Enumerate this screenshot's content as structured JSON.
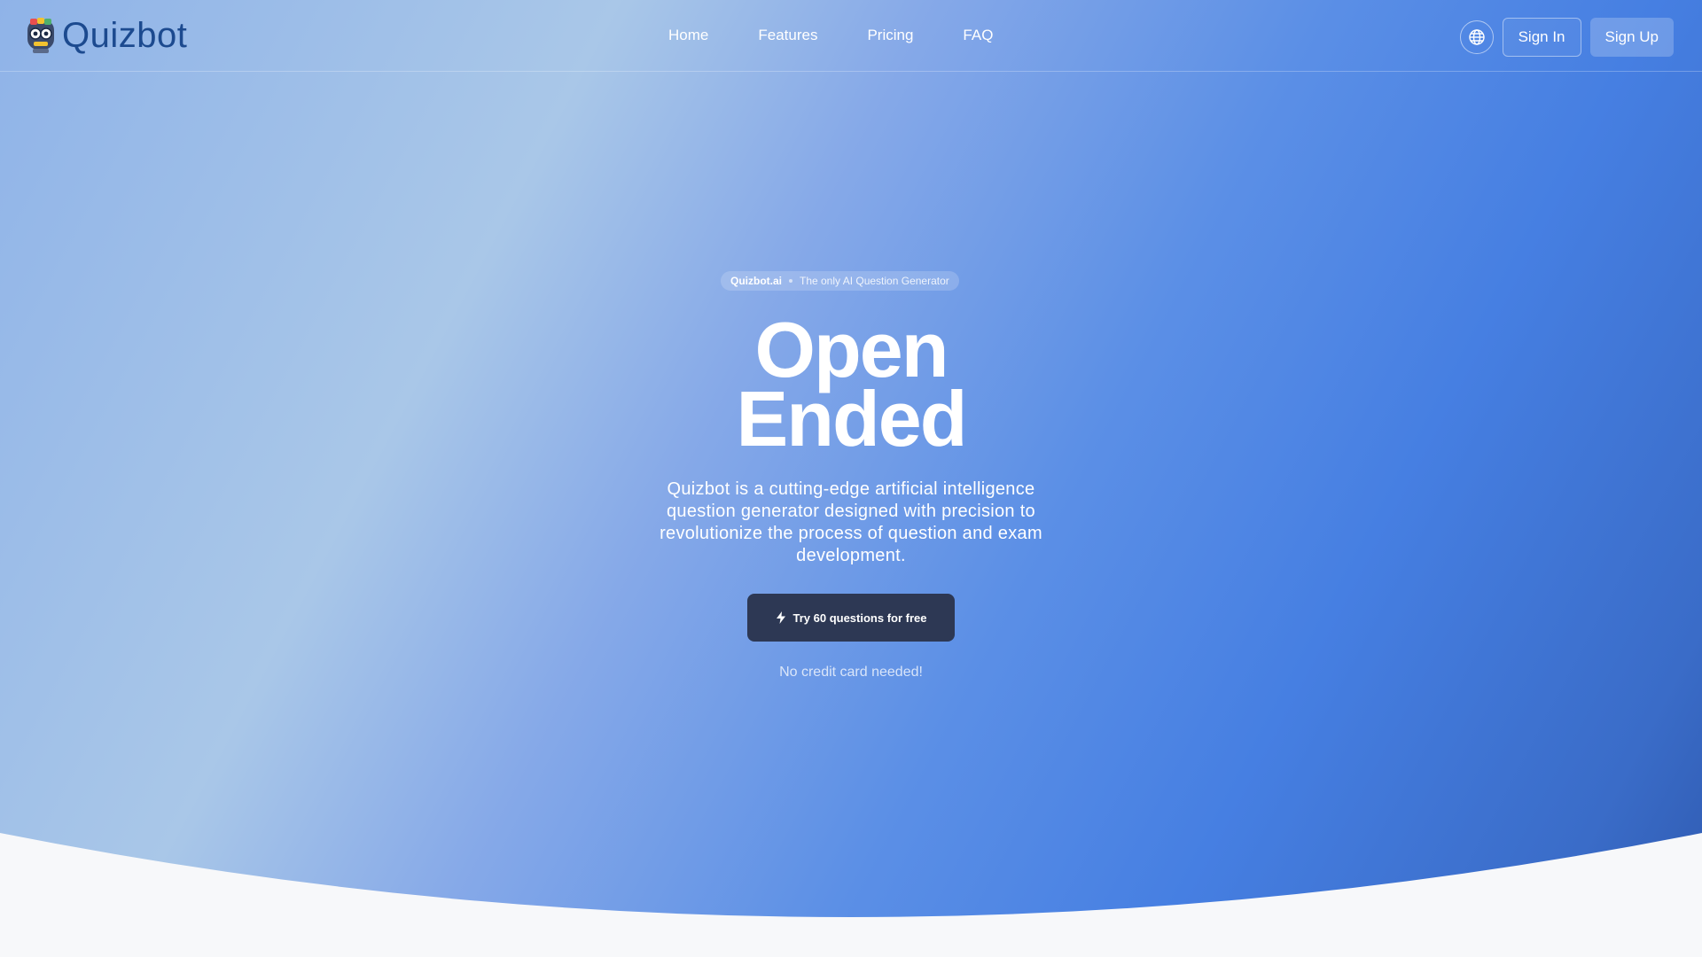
{
  "header": {
    "logo_text": "Quizbot",
    "nav": [
      "Home",
      "Features",
      "Pricing",
      "FAQ"
    ],
    "language_icon": "globe-icon",
    "sign_in": "Sign In",
    "sign_up": "Sign Up"
  },
  "hero": {
    "pill_brand": "Quizbot.ai",
    "pill_text": "The only AI Question Generator",
    "title_line1": "Open",
    "title_line2": "Ended",
    "description": "Quizbot is a cutting-edge artificial intelligence question generator designed with precision to revolutionize the process of question and exam development.",
    "cta_icon": "lightning-icon",
    "cta_label": "Try 60 questions for free",
    "note": "No credit card needed!"
  },
  "colors": {
    "logo_text": "#1c4a8f",
    "cta_background": "#2d3854",
    "page_bottom": "#f7f8fa"
  }
}
